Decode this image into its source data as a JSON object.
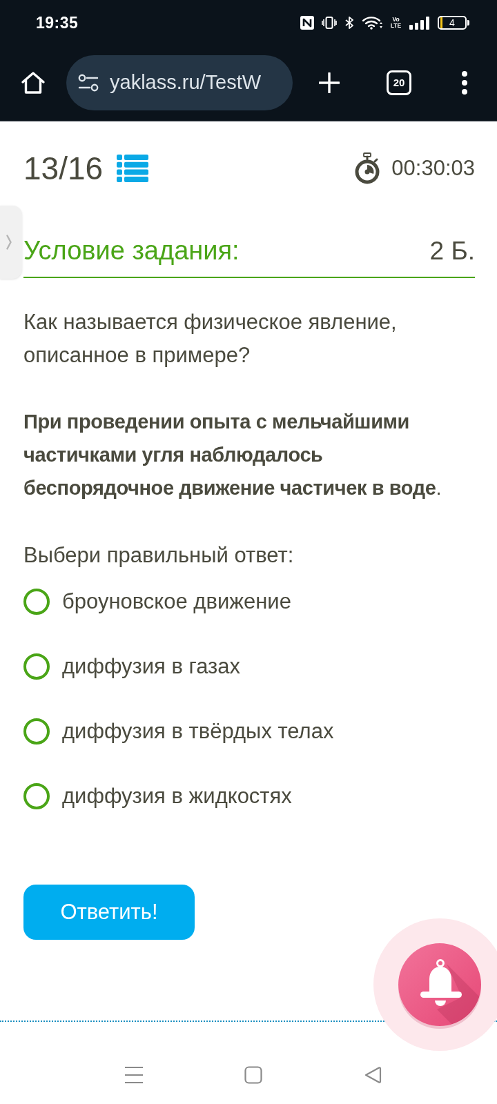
{
  "status_bar": {
    "time": "19:35",
    "network_label": "Vo LTE",
    "battery": "4"
  },
  "browser_toolbar": {
    "url": "yaklass.ru/TestW",
    "tab_count": "20"
  },
  "test_header": {
    "counter": "13/16",
    "timer": "00:30:03"
  },
  "task": {
    "heading": "Условие задания:",
    "points": "2 Б.",
    "question": "Как называется физическое явление, описанное в примере?",
    "example": "**При проведении опыта с мельчайшими частичками угля наблюдалось беспорядочное движение частичек в воде**.",
    "prompt": "Выбери правильный ответ:",
    "options": [
      {
        "label": "броуновское движение",
        "selected": false
      },
      {
        "label": "диффузия в газах",
        "selected": false
      },
      {
        "label": "диффузия в твёрдых телах",
        "selected": false
      },
      {
        "label": "диффузия в жидкостях",
        "selected": false
      }
    ],
    "submit_button": "Ответить!"
  }
}
